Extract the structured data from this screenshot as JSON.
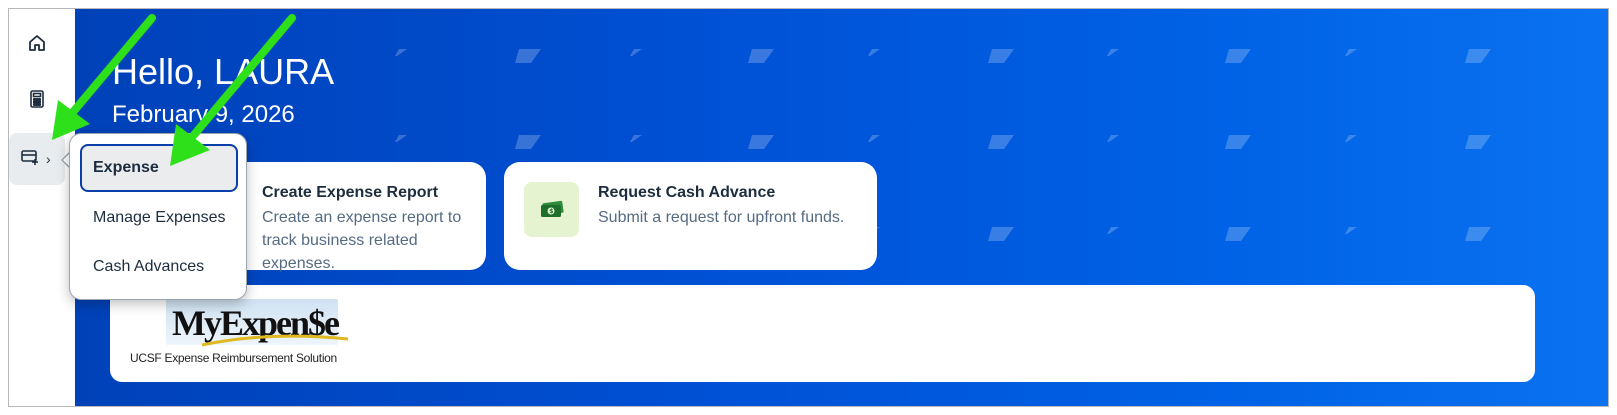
{
  "sidebar": {
    "items": [
      {
        "icon": "home-icon"
      },
      {
        "icon": "calculator-icon"
      },
      {
        "icon": "expense-add-icon",
        "chevron": "›"
      }
    ]
  },
  "hero": {
    "greeting": "Hello, LAURA",
    "date": "February 9, 2026"
  },
  "cards": [
    {
      "title": "Create Expense Report",
      "description": "Create an expense report to track business related expenses."
    },
    {
      "title": "Request Cash Advance",
      "description": "Submit a request for upfront funds.",
      "icon": "cash-icon"
    }
  ],
  "logo": {
    "title": "MyExpen$e",
    "subtitle": "UCSF Expense Reimbursement Solution"
  },
  "menu": {
    "items": [
      {
        "label": "Expense",
        "selected": true
      },
      {
        "label": "Manage Expenses"
      },
      {
        "label": "Cash Advances"
      }
    ]
  },
  "colors": {
    "hero_start": "#0041b8",
    "hero_end": "#0a72f0",
    "annotation_arrow": "#2ee01a",
    "cash_icon_bg": "#e6f3d0",
    "menu_focus": "#0a3ea8"
  }
}
